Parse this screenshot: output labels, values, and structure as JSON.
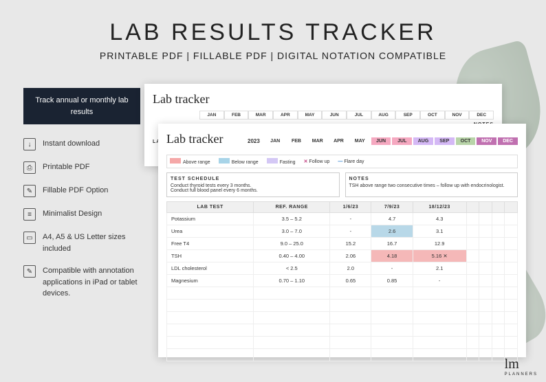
{
  "hero": {
    "title": "LAB RESULTS TRACKER",
    "subtitle": "PRINTABLE PDF | FILLABLE PDF | DIGITAL NOTATION COMPATIBLE"
  },
  "badge": "Track annual or monthly lab results",
  "features": [
    {
      "icon": "↓",
      "text": "Instant download"
    },
    {
      "icon": "⎙",
      "text": "Printable PDF"
    },
    {
      "icon": "✎",
      "text": "Fillable PDF Option"
    },
    {
      "icon": "≡",
      "text": "Minimalist Design"
    },
    {
      "icon": "▭",
      "text": "A4, A5 & US Letter sizes included"
    },
    {
      "icon": "✎",
      "text": "Compatible with annotation applications in iPad or tablet devices."
    }
  ],
  "sheet": {
    "title": "Lab tracker",
    "year": "2023",
    "months": [
      "JAN",
      "FEB",
      "MAR",
      "APR",
      "MAY",
      "JUN",
      "JUL",
      "AUG",
      "SEP",
      "OCT",
      "NOV",
      "DEC"
    ],
    "legend": {
      "above": "Above range",
      "below": "Below range",
      "fasting": "Fasting",
      "followup": "Follow up",
      "flare": "Flare day"
    },
    "schedule_title": "TEST SCHEDULE",
    "schedule_text": "Conduct thyroid tests every 3 months.\nConduct full blood panel every 6 months.",
    "notes_title": "NOTES",
    "notes_text": "TSH above range two consecutive times – follow up with endocrinologist.",
    "headers": [
      "LAB TEST",
      "REF. RANGE",
      "1/6/23",
      "7/9/23",
      "18/12/23",
      "",
      "",
      "",
      ""
    ],
    "rows": [
      {
        "test": "Potassium",
        "range": "3.5 – 5.2",
        "v": [
          "-",
          "4.7",
          "4.3",
          "",
          "",
          "",
          ""
        ],
        "cls": [
          "",
          "",
          "",
          "",
          "",
          "",
          ""
        ]
      },
      {
        "test": "Urea",
        "range": "3.0 – 7.0",
        "v": [
          "-",
          "2.6",
          "3.1",
          "",
          "",
          "",
          ""
        ],
        "cls": [
          "",
          "c-below",
          "",
          "",
          "",
          "",
          ""
        ]
      },
      {
        "test": "Free T4",
        "range": "9.0 – 25.0",
        "v": [
          "15.2",
          "16.7",
          "12.9",
          "",
          "",
          "",
          ""
        ],
        "cls": [
          "",
          "",
          "",
          "",
          "",
          "",
          ""
        ]
      },
      {
        "test": "TSH",
        "range": "0.40 – 4.00",
        "v": [
          "2.06",
          "4.18",
          "5.16 ✕",
          "",
          "",
          "",
          ""
        ],
        "cls": [
          "",
          "c-above",
          "c-above",
          "",
          "",
          "",
          ""
        ]
      },
      {
        "test": "LDL cholesterol",
        "range": "< 2.5",
        "v": [
          "2.0",
          "-",
          "2.1",
          "",
          "",
          "",
          ""
        ],
        "cls": [
          "",
          "",
          "",
          "",
          "",
          "",
          ""
        ]
      },
      {
        "test": "Magnesium",
        "range": "0.70 – 1.10",
        "v": [
          "0.65",
          "0.85",
          "-",
          "",
          "",
          "",
          ""
        ],
        "cls": [
          "",
          "",
          "",
          "",
          "",
          "",
          ""
        ]
      }
    ]
  },
  "back_sheet": {
    "title": "Lab tracker",
    "notes": "NOTES",
    "labtest": "LAB TEST"
  },
  "logo": {
    "main": "lm",
    "sub": "PLANNERS"
  }
}
